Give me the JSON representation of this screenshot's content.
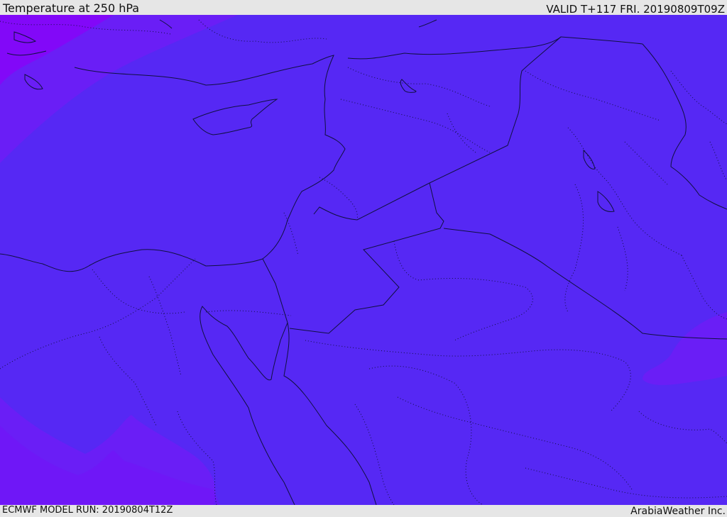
{
  "header": {
    "title": "Temperature at 250 hPa",
    "valid": "VALID T+117 FRI. 20190809T09Z"
  },
  "footer": {
    "model_run": "ECMWF MODEL RUN: 20190804T12Z",
    "credit": "ArabiaWeather Inc."
  },
  "map": {
    "colors": {
      "base": "#5628f4",
      "cool_band": "#6a1ef6",
      "cold_corner": "#8208f8",
      "border": "#101040"
    }
  }
}
